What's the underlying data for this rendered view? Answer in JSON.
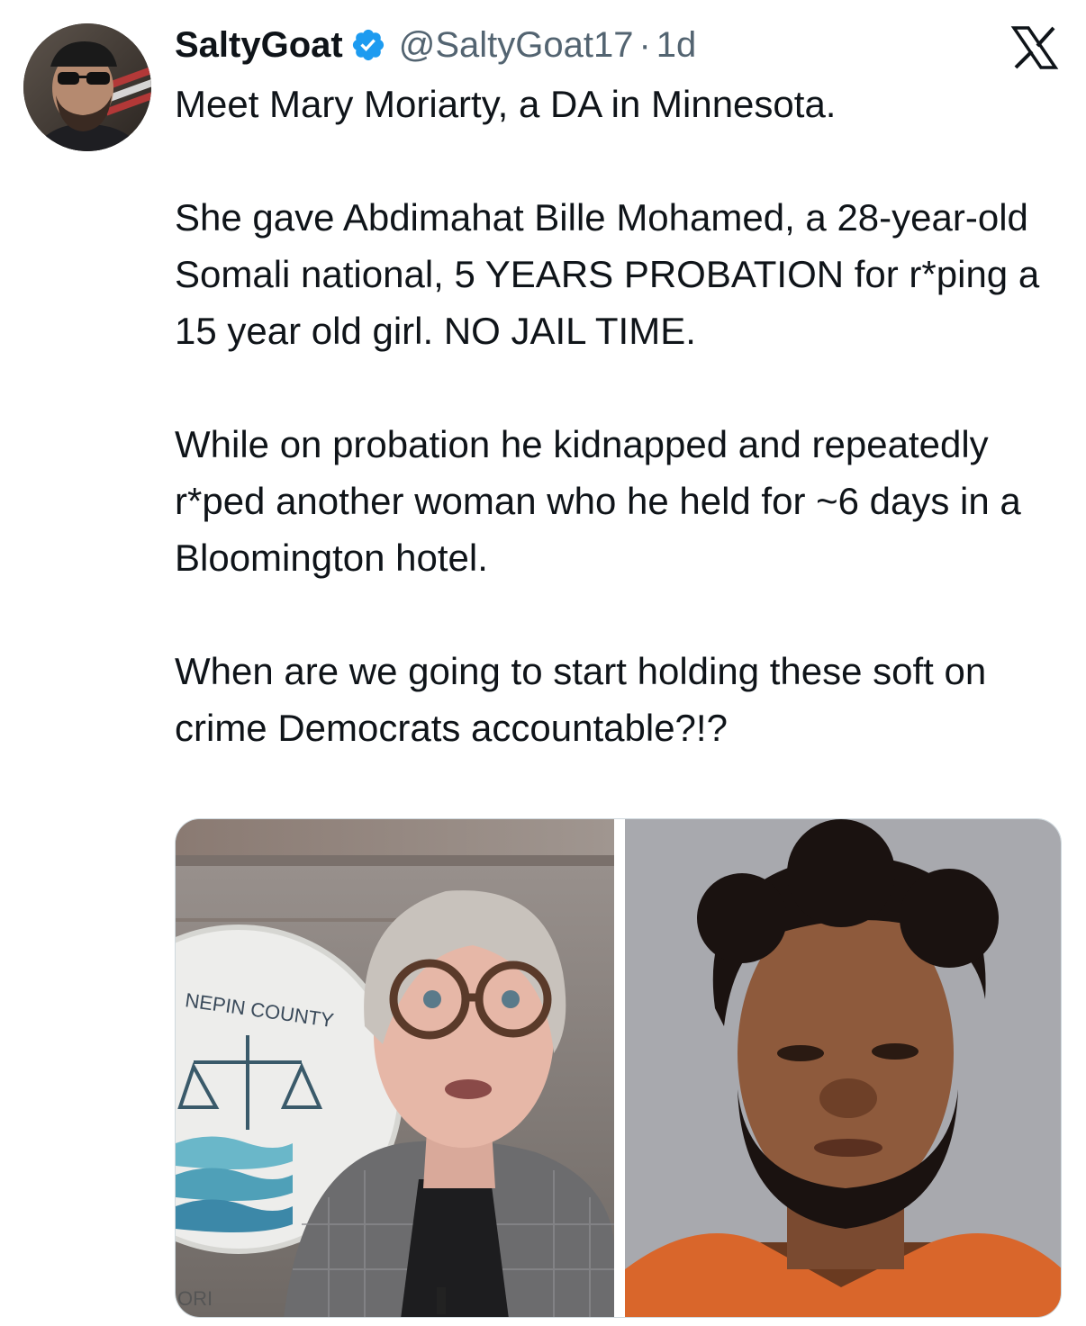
{
  "author": {
    "display_name": "SaltyGoat",
    "handle": "@SaltyGoat17",
    "separator": "·",
    "time": "1d",
    "verified": true,
    "avatar_icon": "profile-photo"
  },
  "platform_logo": "x-logo-icon",
  "tweet": {
    "paragraphs": [
      "Meet Mary Moriarty, a DA in Minnesota.",
      "She gave Abdimahat Bille Mohamed, a 28-year-old Somali national, 5 YEARS PROBATION for r*ping a 15 year old girl.  NO JAIL TIME.",
      "While on probation he kidnapped and repeatedly r*ped another woman who he held for ~6 days in a Bloomington hotel.",
      "When are we going to start holding these soft on crime Democrats accountable?!?"
    ]
  },
  "media": {
    "left_image": {
      "sign_text": "NEPIN COUNTY",
      "sign_text_bottom": "ORI"
    },
    "right_image": {
      "description_icon": "mugshot-photo"
    }
  },
  "colors": {
    "verified_badge": "#1d9bf0",
    "secondary_text": "#536471",
    "primary_text": "#0f1419"
  }
}
